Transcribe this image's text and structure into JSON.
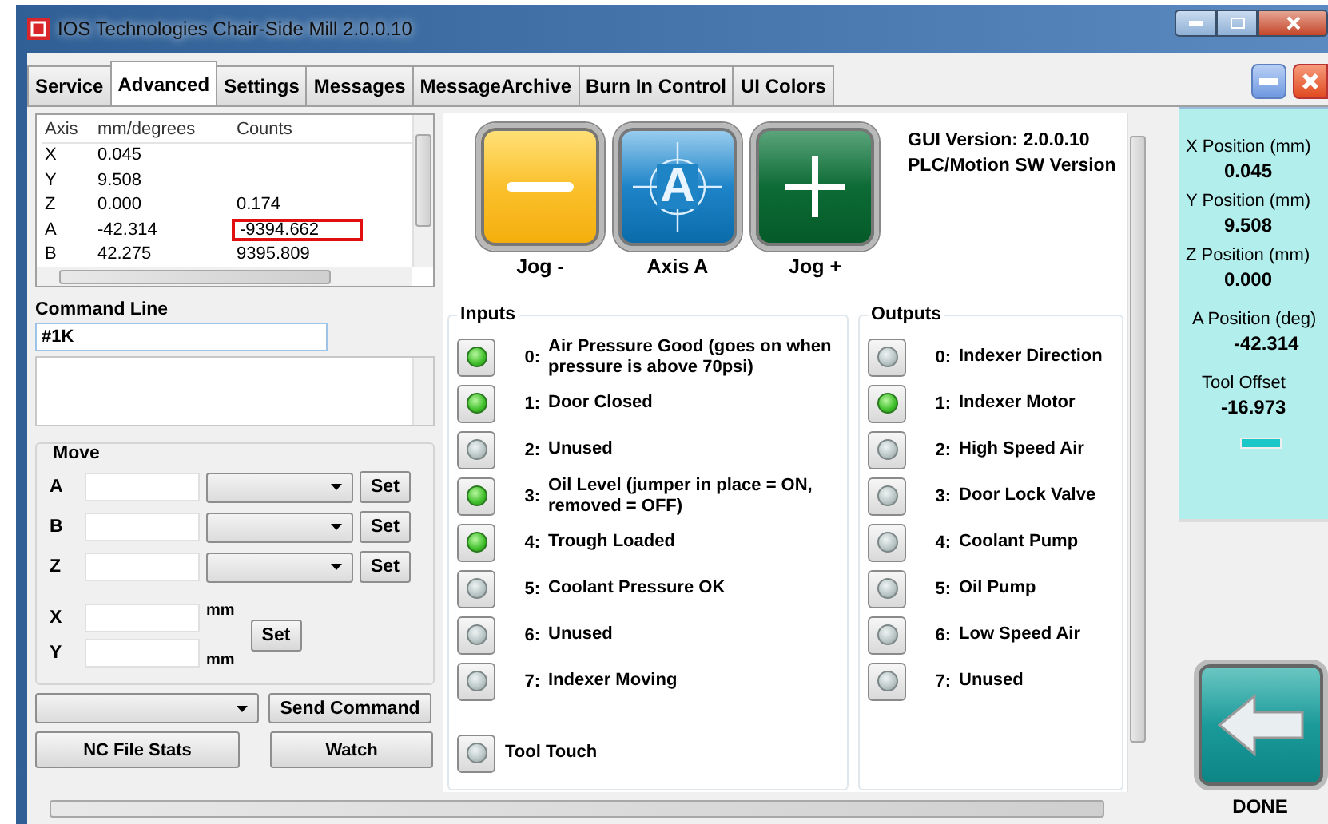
{
  "window": {
    "title": "IOS Technologies Chair-Side Mill 2.0.0.10"
  },
  "tabs": [
    {
      "label": "Service",
      "selected": false
    },
    {
      "label": "Advanced",
      "selected": true
    },
    {
      "label": "Settings",
      "selected": false
    },
    {
      "label": "Messages",
      "selected": false
    },
    {
      "label": "MessageArchive",
      "selected": false
    },
    {
      "label": "Burn In Control",
      "selected": false
    },
    {
      "label": "UI Colors",
      "selected": false
    }
  ],
  "axis_table": {
    "columns": [
      "Axis",
      "mm/degrees",
      "Counts"
    ],
    "rows": [
      {
        "axis": "X",
        "mm_degrees": "0.045",
        "highlighted": false
      },
      {
        "axis": "Y",
        "mm_degrees": "9.508",
        "highlighted": false
      },
      {
        "axis": "Z",
        "mm_degrees": "0.000",
        "counts": "0.174",
        "highlighted": false
      },
      {
        "axis": "A",
        "mm_degrees": "-42.314",
        "counts": "-9394.662",
        "highlighted": true
      },
      {
        "axis": "B",
        "mm_degrees": "42.275",
        "counts": "9395.809",
        "highlighted": false
      }
    ]
  },
  "command_line": {
    "label": "Command Line",
    "value": "#1K"
  },
  "move": {
    "title": "Move",
    "axes": [
      {
        "label": "A",
        "button": "Set"
      },
      {
        "label": "B",
        "button": "Set"
      },
      {
        "label": "Z",
        "button": "Set"
      }
    ],
    "xy": {
      "rows": [
        {
          "label": "X",
          "unit": "mm"
        },
        {
          "label": "Y",
          "unit": "mm"
        }
      ],
      "button": "Set"
    }
  },
  "send_command": "Send Command",
  "buttons": [
    "NC File Stats",
    "Watch"
  ],
  "jog_buttons": [
    {
      "kind": "minus",
      "label": "Jog -"
    },
    {
      "kind": "axis",
      "symbol": "A",
      "label": "Axis A"
    },
    {
      "kind": "plus",
      "label": "Jog +"
    }
  ],
  "versions": [
    "GUI Version: 2.0.0.10",
    "PLC/Motion SW Version"
  ],
  "inputs": {
    "title": "Inputs",
    "items": [
      {
        "index": "0:",
        "label": "Air Pressure Good (goes on when pressure is above 70psi)",
        "on": true
      },
      {
        "index": "1:",
        "label": "Door Closed",
        "on": true
      },
      {
        "index": "2:",
        "label": "Unused",
        "on": false
      },
      {
        "index": "3:",
        "label": "Oil Level (jumper in place = ON, removed = OFF)",
        "on": true
      },
      {
        "index": "4:",
        "label": "Trough Loaded",
        "on": true
      },
      {
        "index": "5:",
        "label": "Coolant Pressure OK",
        "on": false
      },
      {
        "index": "6:",
        "label": "Unused",
        "on": false
      },
      {
        "index": "7:",
        "label": "Indexer Moving",
        "on": false
      }
    ],
    "tool_touch": {
      "label": "Tool Touch",
      "on": false
    }
  },
  "outputs": {
    "title": "Outputs",
    "items": [
      {
        "index": "0:",
        "label": "Indexer Direction",
        "on": false
      },
      {
        "index": "1:",
        "label": "Indexer Motor",
        "on": true
      },
      {
        "index": "2:",
        "label": "High Speed Air",
        "on": false
      },
      {
        "index": "3:",
        "label": "Door Lock Valve",
        "on": false
      },
      {
        "index": "4:",
        "label": "Coolant Pump",
        "on": false
      },
      {
        "index": "5:",
        "label": "Oil Pump",
        "on": false
      },
      {
        "index": "6:",
        "label": "Low Speed Air",
        "on": false
      },
      {
        "index": "7:",
        "label": "Unused",
        "on": false
      }
    ]
  },
  "positions": [
    {
      "label": "X Position (mm)",
      "value": "0.045"
    },
    {
      "label": "Y Position (mm)",
      "value": "9.508"
    },
    {
      "label": "Z Position (mm)",
      "value": "0.000"
    },
    {
      "label": "A Position (deg)",
      "value": "-42.314"
    },
    {
      "label": "Tool Offset",
      "value": "-16.973"
    }
  ],
  "done": {
    "label": "DONE"
  }
}
